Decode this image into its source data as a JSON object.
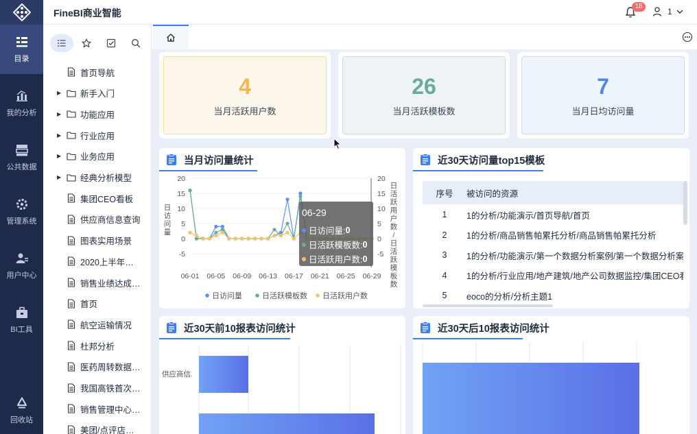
{
  "app": {
    "title": "FineBI商业智能"
  },
  "topbar": {
    "notification_count": "18",
    "user_name": "1"
  },
  "rail": [
    {
      "label": "目录",
      "icon": "catalog-icon",
      "active": true
    },
    {
      "label": "我的分析",
      "icon": "analysis-icon",
      "active": false
    },
    {
      "label": "公共数据",
      "icon": "database-icon",
      "active": false
    },
    {
      "label": "管理系统",
      "icon": "admin-gear-icon",
      "active": false
    },
    {
      "label": "用户中心",
      "icon": "user-center-icon",
      "active": false
    },
    {
      "label": "BI工具",
      "icon": "toolbox-icon",
      "active": false
    },
    {
      "label": "回收站",
      "icon": "recycle-icon",
      "active": false
    }
  ],
  "catalog": {
    "tabs": [
      {
        "icon": "list-icon",
        "active": true
      },
      {
        "icon": "star-icon",
        "active": false
      },
      {
        "icon": "checkbox-icon",
        "active": false
      },
      {
        "icon": "search-icon",
        "active": false
      }
    ],
    "items": [
      {
        "label": "首页导航",
        "type": "file"
      },
      {
        "label": "新手入门",
        "type": "folder"
      },
      {
        "label": "功能应用",
        "type": "folder"
      },
      {
        "label": "行业应用",
        "type": "folder"
      },
      {
        "label": "业务应用",
        "type": "folder"
      },
      {
        "label": "经典分析模型",
        "type": "folder"
      },
      {
        "label": "集团CEO看板",
        "type": "file"
      },
      {
        "label": "供应商信息查询",
        "type": "file"
      },
      {
        "label": "图表实用场景",
        "type": "file"
      },
      {
        "label": "2020上半年…",
        "type": "file"
      },
      {
        "label": "销售业绩达成…",
        "type": "file"
      },
      {
        "label": "首页",
        "type": "file"
      },
      {
        "label": "航空运输情况",
        "type": "file"
      },
      {
        "label": "杜邦分析",
        "type": "file"
      },
      {
        "label": "医药周转数据…",
        "type": "file"
      },
      {
        "label": "我国高铁首次…",
        "type": "file"
      },
      {
        "label": "销售管理中心…",
        "type": "file"
      },
      {
        "label": "美团/点评店…",
        "type": "file"
      }
    ]
  },
  "kpis": [
    {
      "value": "4",
      "label": "当月活跃用户数",
      "color": "#f2b84b",
      "bg": "#fdf6ea",
      "border": "#f6dcaa"
    },
    {
      "value": "26",
      "label": "当月活跃模板数",
      "color": "#6aab9c",
      "bg": "#eef4f5",
      "border": "#c7ddd9"
    },
    {
      "value": "7",
      "label": "当月日均访问量",
      "color": "#4f86ea",
      "bg": "#eef4fc",
      "border": "#c9daf4"
    }
  ],
  "cards": {
    "visits": {
      "title": "当月访问量统计"
    },
    "top15": {
      "title": "近30天访问量top15模板"
    },
    "first10": {
      "title": "近30天前10报表访问统计"
    },
    "last10": {
      "title": "近30天后10报表访问统计"
    }
  },
  "table": {
    "headers": [
      "序号",
      "被访问的资源"
    ],
    "rows": [
      [
        "1",
        "1的分析/功能演示/首页导航/首页"
      ],
      [
        "2",
        "1的分析/商品销售帕累托分析/商品销售帕累托分析"
      ],
      [
        "3",
        "1的分析/功能演示/第一个数据分析案例/第一个数据分析案"
      ],
      [
        "4",
        "1的分析/行业应用/地产建筑/地产公司数据监控/集团CEO看"
      ],
      [
        "5",
        "eoco的分析/分析主题1"
      ]
    ]
  },
  "tooltip": {
    "date": "06-29",
    "rows": [
      {
        "label": "日访问量:",
        "value": "0",
        "color": "#5b8ff0"
      },
      {
        "label": "日活跃模板数:",
        "value": "0",
        "color": "#6aab9c"
      },
      {
        "label": "日活跃用户数:",
        "value": "0",
        "color": "#f2c46a"
      }
    ]
  },
  "bar_left": {
    "category_label": "供应商信."
  },
  "chart_data": [
    {
      "type": "line",
      "title": "当月访问量统计",
      "ylabel": "日访问量",
      "y2label": "日活跃用户数/日活跃模板数",
      "ylim": [
        -5,
        20
      ],
      "y2lim": [
        -5,
        20
      ],
      "yticks": [
        20,
        15,
        10,
        5,
        0,
        -5
      ],
      "xticks": [
        "06-01",
        "06-05",
        "06-09",
        "06-13",
        "06-17",
        "06-21",
        "06-25",
        "06-29"
      ],
      "x": [
        "06-01",
        "06-02",
        "06-03",
        "06-04",
        "06-05",
        "06-06",
        "06-07",
        "06-08",
        "06-09",
        "06-10",
        "06-11",
        "06-12",
        "06-13",
        "06-14",
        "06-15",
        "06-16",
        "06-17",
        "06-18",
        "06-19",
        "06-20",
        "06-21",
        "06-22",
        "06-23",
        "06-24",
        "06-25",
        "06-26",
        "06-27",
        "06-28",
        "06-29"
      ],
      "series": [
        {
          "name": "日访问量",
          "color": "#5b8ff0",
          "values": [
            16,
            0,
            0,
            0,
            4,
            4,
            0,
            0,
            0,
            0,
            0,
            0,
            0,
            1,
            2,
            13,
            0,
            15,
            0,
            0,
            0,
            0,
            0,
            0,
            0,
            0,
            0,
            0,
            0
          ]
        },
        {
          "name": "日活跃模板数",
          "color": "#6aab9c",
          "values": [
            16,
            0,
            0,
            0,
            2,
            3,
            0,
            0,
            0,
            0,
            0,
            0,
            0,
            3,
            1,
            5,
            0,
            14,
            0,
            0,
            0,
            0,
            0,
            0,
            0,
            0,
            0,
            0,
            0
          ]
        },
        {
          "name": "日活跃用户数",
          "color": "#f2c46a",
          "values": [
            2,
            1,
            0,
            0,
            1,
            2,
            0,
            0,
            0,
            0,
            0,
            0,
            0,
            1,
            1,
            2,
            0,
            2,
            0,
            0,
            0,
            0,
            0,
            0,
            0,
            0,
            0,
            0,
            0
          ]
        }
      ],
      "legend": "bottom"
    }
  ]
}
